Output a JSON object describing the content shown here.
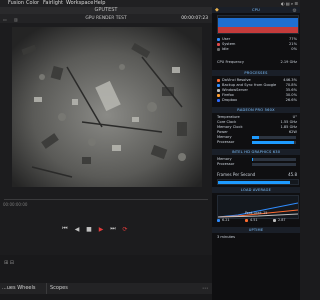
{
  "menubar": {
    "items": [
      "Fusion",
      "Color",
      "Fairlight",
      "Workspace",
      "Help"
    ],
    "right": "◐ ▤ ⌕ ☰"
  },
  "app": {
    "window_title": "GPUTEST",
    "viewer_title": "GPU RENDER TEST",
    "timecode": "00:00:07:23",
    "timeline_start": "00:00:00:00",
    "lower_tabs": [
      "...ues Wheels",
      "Scopes"
    ]
  },
  "stats": {
    "sections": {
      "cpu": "CPU",
      "processes": "PROCESSES",
      "gpu": "RADEON PRO 560X",
      "intel": "INTEL HD GRAPHICS 630",
      "load": "LOAD AVERAGE",
      "uptime": "UPTIME"
    },
    "cpu_rows": [
      {
        "label": "User",
        "value": "77%",
        "color": "#2f8cff",
        "frac": 0.77
      },
      {
        "label": "System",
        "value": "21%",
        "color": "#e04a4a",
        "frac": 0.21
      },
      {
        "label": "Idle",
        "value": "0%",
        "color": "#6b6b6b",
        "frac": 0.0
      }
    ],
    "cpu_freq_label": "CPU Frequency",
    "cpu_freq_value": "2.19 GHz",
    "processes": [
      {
        "name": "DaVinci Resolve",
        "value": "446.3%",
        "color": "#ff6b2f"
      },
      {
        "name": "Backup and Sync from Google",
        "value": "70.8%",
        "color": "#2f8cff"
      },
      {
        "name": "WindowServer",
        "value": "35.6%",
        "color": "#bfbfbf"
      },
      {
        "name": "Firefox",
        "value": "30.0%",
        "color": "#ff9d2f"
      },
      {
        "name": "Dropbox",
        "value": "26.6%",
        "color": "#2f6bff"
      }
    ],
    "gpu_rows": [
      {
        "label": "Temperature",
        "value": "U°"
      },
      {
        "label": "Core Clock",
        "value": "1.55 GHz"
      },
      {
        "label": "Memory Clock",
        "value": "1.85 GHz"
      },
      {
        "label": "Power",
        "value": "62W"
      },
      {
        "label": "Memory",
        "value": ""
      },
      {
        "label": "Processor",
        "value": ""
      }
    ],
    "gpu_memory_frac": 0.15,
    "gpu_processor_frac": 0.95,
    "intel_rows": [
      {
        "label": "Memory",
        "value": ""
      },
      {
        "label": "Processor",
        "value": ""
      }
    ],
    "intel_memory_frac": 0.03,
    "intel_processor_frac": 0.0,
    "fps_label": "Frames Per Second",
    "fps_value": "45.8",
    "peak_load": "Peak Load: 25",
    "load_values": [
      {
        "label": "6.21",
        "color": "#2f8cff"
      },
      {
        "label": "4.51",
        "color": "#ff6b2f"
      },
      {
        "label": "2.87",
        "color": "#bfbfbf"
      }
    ],
    "uptime_value": "3 minutes"
  },
  "icons": {
    "apple": "",
    "gear": "⚙",
    "stats_app": "◆",
    "prev": "⏮",
    "back": "◀",
    "stop": "■",
    "play": "▶",
    "next": "⏭",
    "loop": "⟳",
    "more": "⋯"
  }
}
